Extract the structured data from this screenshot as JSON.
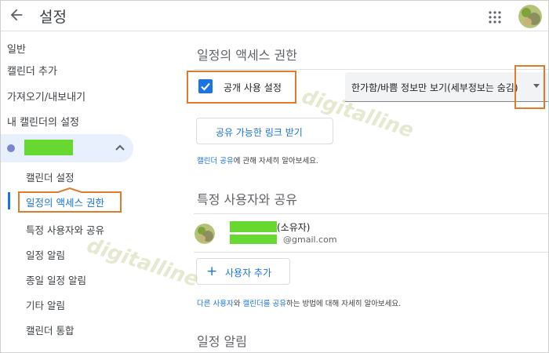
{
  "header": {
    "title": "설정"
  },
  "sidebar": {
    "top_items": [
      {
        "label": "일반"
      },
      {
        "label": "캘린더 추가"
      },
      {
        "label": "가져오기/내보내기"
      },
      {
        "label": "내 캘린더의 설정"
      }
    ],
    "sub_items": [
      {
        "label": "캘린더 설정"
      },
      {
        "label": "일정의 액세스 권한"
      },
      {
        "label": "특정 사용자와 공유"
      },
      {
        "label": "일정 알림"
      },
      {
        "label": "종일 일정 알림"
      },
      {
        "label": "기타 알림"
      },
      {
        "label": "캘린더 통합"
      }
    ]
  },
  "main": {
    "access_title": "일정의 액세스 권한",
    "public_checkbox_label": "공개 사용 설정",
    "public_checkbox_checked": true,
    "visibility_select_value": "한가함/바쁨 정보만 보기(세부정보는 숨김)",
    "share_link_button": "공유 가능한 링크 받기",
    "share_help": {
      "link": "캘린더 공유",
      "rest": "에 관해 자세히 알아보세요."
    },
    "share_users_title": "특정 사용자와 공유",
    "user": {
      "role": "(소유자)",
      "email": "@gmail.com"
    },
    "add_user_button": "사용자 추가",
    "share_users_help": {
      "link1": "다른 사용자",
      "mid1": "와 ",
      "link2": "캘린더를 공유",
      "rest": "하는 방법에 대해 자세히 알아보세요."
    },
    "notifications_title": "일정 알림"
  },
  "watermark": "digitalline",
  "colors": {
    "accent": "#1a73e8",
    "highlight_outline": "#e07b2b",
    "redaction": "#67d82f",
    "calendar_dot": "#7986cb"
  }
}
